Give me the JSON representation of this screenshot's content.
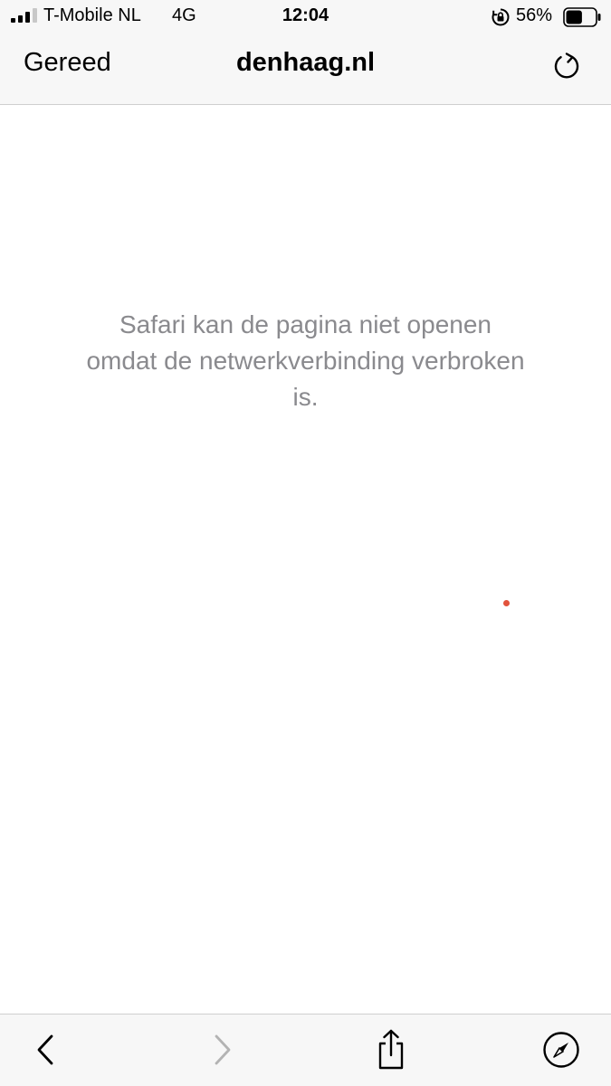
{
  "status_bar": {
    "carrier": "T-Mobile NL",
    "network": "4G",
    "time": "12:04",
    "battery_percent": "56%",
    "signal_bars_active": 3,
    "signal_bars_total": 4,
    "battery_level": 0.56
  },
  "navbar": {
    "done_label": "Gereed",
    "title": "denhaag.nl"
  },
  "content": {
    "error_message": "Safari kan de pagina niet openen omdat de netwerkverbinding verbroken is."
  },
  "icons": {
    "signal": "signal-bars-icon",
    "rotation_lock": "rotation-lock-icon",
    "battery": "battery-icon",
    "reload": "reload-icon",
    "back": "chevron-left-icon",
    "forward": "chevron-right-icon",
    "share": "share-icon",
    "safari": "compass-icon"
  },
  "colors": {
    "bar_background": "#f7f7f7",
    "error_text": "#8a8a8e",
    "disabled_icon": "#b3b3b3",
    "dot": "#e2533c"
  }
}
